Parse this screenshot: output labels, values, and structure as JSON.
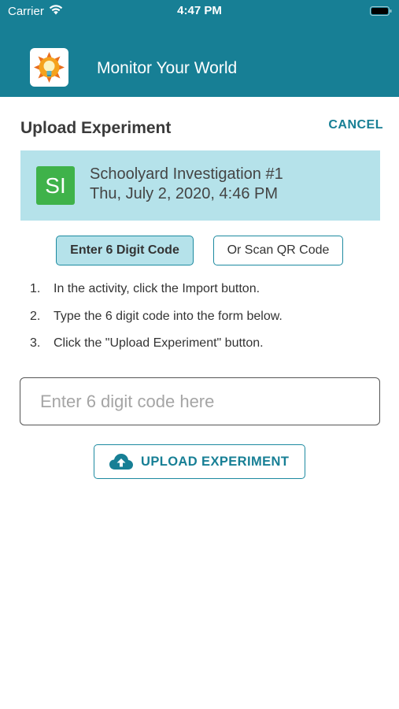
{
  "status_bar": {
    "carrier": "Carrier",
    "time": "4:47 PM"
  },
  "header": {
    "app_title": "Monitor Your World",
    "logo_icon": "lightbulb-sun-icon",
    "background_color": "#177f95"
  },
  "page": {
    "title": "Upload Experiment",
    "cancel_label": "CANCEL"
  },
  "experiment": {
    "badge": "SI",
    "badge_color": "#3fb24a",
    "name": "Schoolyard Investigation #1",
    "date": "Thu, July 2, 2020, 4:46 PM"
  },
  "mode_tabs": {
    "code_label": "Enter 6 Digit Code",
    "qr_label": "Or Scan QR Code",
    "selected": "code"
  },
  "instructions": [
    {
      "num": "1.",
      "text": "In the activity, click the Import button."
    },
    {
      "num": "2.",
      "text": "Type the 6 digit code into the form below."
    },
    {
      "num": "3.",
      "text": "Click the \"Upload Experiment\" button."
    }
  ],
  "code_input": {
    "placeholder": "Enter 6 digit code here",
    "value": ""
  },
  "upload": {
    "label": "UPLOAD EXPERIMENT",
    "icon": "cloud-upload-icon"
  }
}
